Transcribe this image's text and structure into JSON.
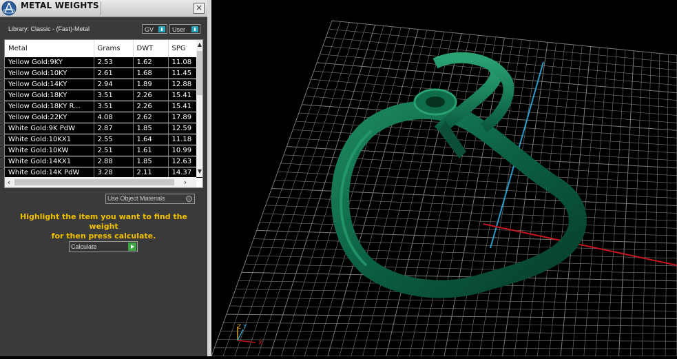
{
  "panel": {
    "title": "METAL WEIGHTS",
    "close_icon": "×",
    "library_label": "Library: Classic - (Fast)-Metal",
    "toggles": [
      {
        "label": "GV",
        "state": "on"
      },
      {
        "label": "User",
        "state": "on"
      }
    ],
    "columns": [
      "Metal",
      "Grams",
      "DWT",
      "SPG"
    ],
    "rows": [
      [
        "Yellow Gold:9KY",
        "2.53",
        "1.62",
        "11.08"
      ],
      [
        "Yellow Gold:10KY",
        "2.61",
        "1.68",
        "11.45"
      ],
      [
        "Yellow Gold:14KY",
        "2.94",
        "1.89",
        "12.88"
      ],
      [
        "Yellow Gold:18KY",
        "3.51",
        "2.26",
        "15.41"
      ],
      [
        "Yellow Gold:18KY R...",
        "3.51",
        "2.26",
        "15.41"
      ],
      [
        "Yellow Gold:22KY",
        "4.08",
        "2.62",
        "17.89"
      ],
      [
        "White Gold:9K PdW",
        "2.87",
        "1.85",
        "12.59"
      ],
      [
        "White Gold:10KX1",
        "2.55",
        "1.64",
        "11.18"
      ],
      [
        "White Gold:10KW",
        "2.51",
        "1.61",
        "10.99"
      ],
      [
        "White Gold:14KX1",
        "2.88",
        "1.85",
        "12.63"
      ],
      [
        "White Gold:14K PdW",
        "3.28",
        "2.11",
        "14.37"
      ]
    ],
    "use_object_materials_label": "Use Object Materials",
    "hint_line1": "Highlight the item you want to find the weight",
    "hint_line2": "for then press calculate.",
    "calculate_label": "Calculate"
  },
  "viewport": {
    "axis_labels": {
      "x": "X",
      "y": "Y",
      "z": "Z"
    },
    "colors": {
      "background": "#000000",
      "grid": "#7a7a7a",
      "ring": "#0c6a4a",
      "x_axis": "#c8141e",
      "y_axis": "#2a9ec8"
    }
  }
}
